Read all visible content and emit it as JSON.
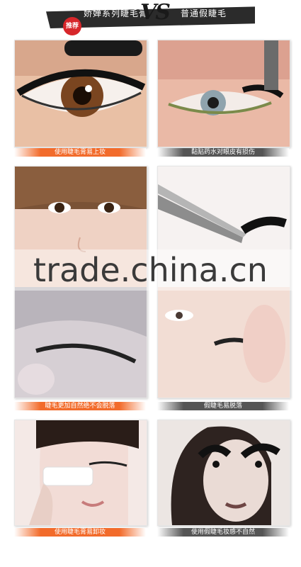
{
  "header": {
    "badge": "推荐",
    "left_text": "娇婵系列睫毛膏",
    "vs": "VS",
    "right_text": "普通假睫毛"
  },
  "panels": [
    {
      "caption": "使用睫毛膏易上妆",
      "style": "orange"
    },
    {
      "caption": "黏贴药水对眼皮有损伤",
      "style": "gray"
    },
    {
      "caption": "睫毛更加自然绝不会脱落",
      "style": "orange"
    },
    {
      "caption": "假睫毛易脱落",
      "style": "gray"
    },
    {
      "caption": "使用睫毛膏易卸妆",
      "style": "orange"
    },
    {
      "caption": "使用假睫毛妆感不自然",
      "style": "gray"
    }
  ],
  "watermark": "trade.china.cn",
  "colors": {
    "accent_orange": "#f26b2b",
    "caption_gray": "#555555",
    "badge_red": "#d7262a"
  }
}
